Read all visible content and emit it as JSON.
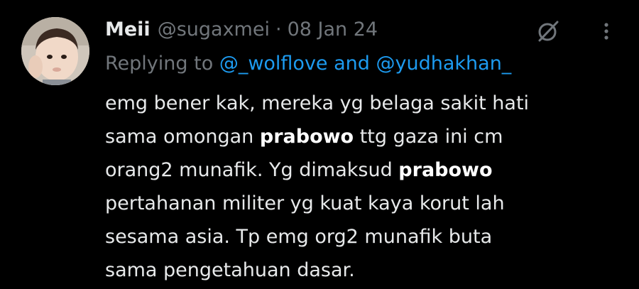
{
  "tweet": {
    "display_name": "Meii",
    "handle": "@sugaxmei",
    "separator": "·",
    "date": "08 Jan 24",
    "reply_prefix": "Replying to",
    "reply_mention_1": "@_wolflove",
    "reply_conjunction": "and",
    "reply_mention_2": "@yudhakhan_",
    "text_lines": [
      {
        "parts": [
          {
            "t": "emg bener kak, mereka yg belaga sakit hati",
            "b": false
          }
        ]
      },
      {
        "parts": [
          {
            "t": "sama omongan ",
            "b": false
          },
          {
            "t": "prabowo",
            "b": true
          },
          {
            "t": " ttg gaza ini cm",
            "b": false
          }
        ]
      },
      {
        "parts": [
          {
            "t": "orang2 munafik. Yg dimaksud ",
            "b": false
          },
          {
            "t": "prabowo",
            "b": true
          }
        ]
      },
      {
        "parts": [
          {
            "t": "pertahanan militer yg kuat kaya korut lah",
            "b": false
          }
        ]
      },
      {
        "parts": [
          {
            "t": "sesama asia. Tp emg org2 munafik buta",
            "b": false
          }
        ]
      },
      {
        "parts": [
          {
            "t": "sama pengetahuan dasar.",
            "b": false
          }
        ]
      }
    ]
  },
  "icons": {
    "grok": "grok-icon",
    "more": "more-options-icon",
    "avatar": "avatar"
  },
  "colors": {
    "background": "#000000",
    "primary_text": "#e7e9ea",
    "secondary_text": "#71767b",
    "link": "#1d9bf0"
  }
}
